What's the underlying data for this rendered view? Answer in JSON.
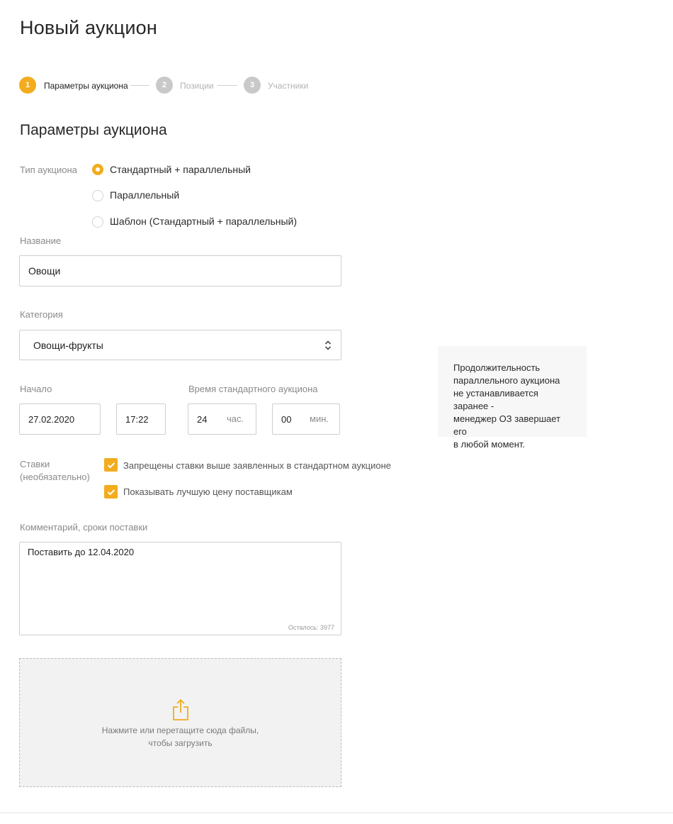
{
  "page": {
    "title": "Новый аукцион"
  },
  "stepper": {
    "steps": [
      {
        "number": "1",
        "label": "Параметры аукциона",
        "state": "active"
      },
      {
        "number": "2",
        "label": "Позиции",
        "state": "inactive"
      },
      {
        "number": "3",
        "label": "Участники",
        "state": "inactive"
      }
    ]
  },
  "section": {
    "title": "Параметры аукциона"
  },
  "auction_type": {
    "label": "Тип аукциона",
    "options": [
      {
        "label": "Стандартный + параллельный",
        "checked": true
      },
      {
        "label": "Параллельный",
        "checked": false
      },
      {
        "label": "Шаблон (Стандартный + параллельный)",
        "checked": false
      }
    ]
  },
  "name_field": {
    "label": "Название",
    "value": "Овощи"
  },
  "category_field": {
    "label": "Категория",
    "value": "Овощи-фрукты"
  },
  "start": {
    "label": "Начало",
    "date": "27.02.2020",
    "time": "17:22"
  },
  "standard_time": {
    "label": "Время стандартного аукциона",
    "hours": "24",
    "hours_unit": "час.",
    "minutes": "00",
    "minutes_unit": "мин."
  },
  "bids": {
    "label_line1": "Ставки",
    "label_line2": "(необязательно)",
    "options": [
      {
        "label": "Запрещены ставки выше заявленных в стандартном аукционе",
        "checked": true
      },
      {
        "label": "Показывать лучшую цену поставщикам",
        "checked": true
      }
    ]
  },
  "comment": {
    "label": "Комментарий, сроки поставки",
    "value": "Поставить до 12.04.2020",
    "remaining": "Осталось: 3977"
  },
  "upload": {
    "icon": "upload-icon",
    "line1": "Нажмите или перетащите сюда файлы,",
    "line2": "чтобы загрузить"
  },
  "hint": {
    "lines": [
      "Продолжительность",
      "параллельного аукциона",
      "не устанавливается заранее -",
      "менеджер ОЗ завершает его",
      "в любой момент."
    ]
  },
  "colors": {
    "accent": "#f2ac1d",
    "muted": "#8a8a8a",
    "border": "#cfcfcf"
  }
}
